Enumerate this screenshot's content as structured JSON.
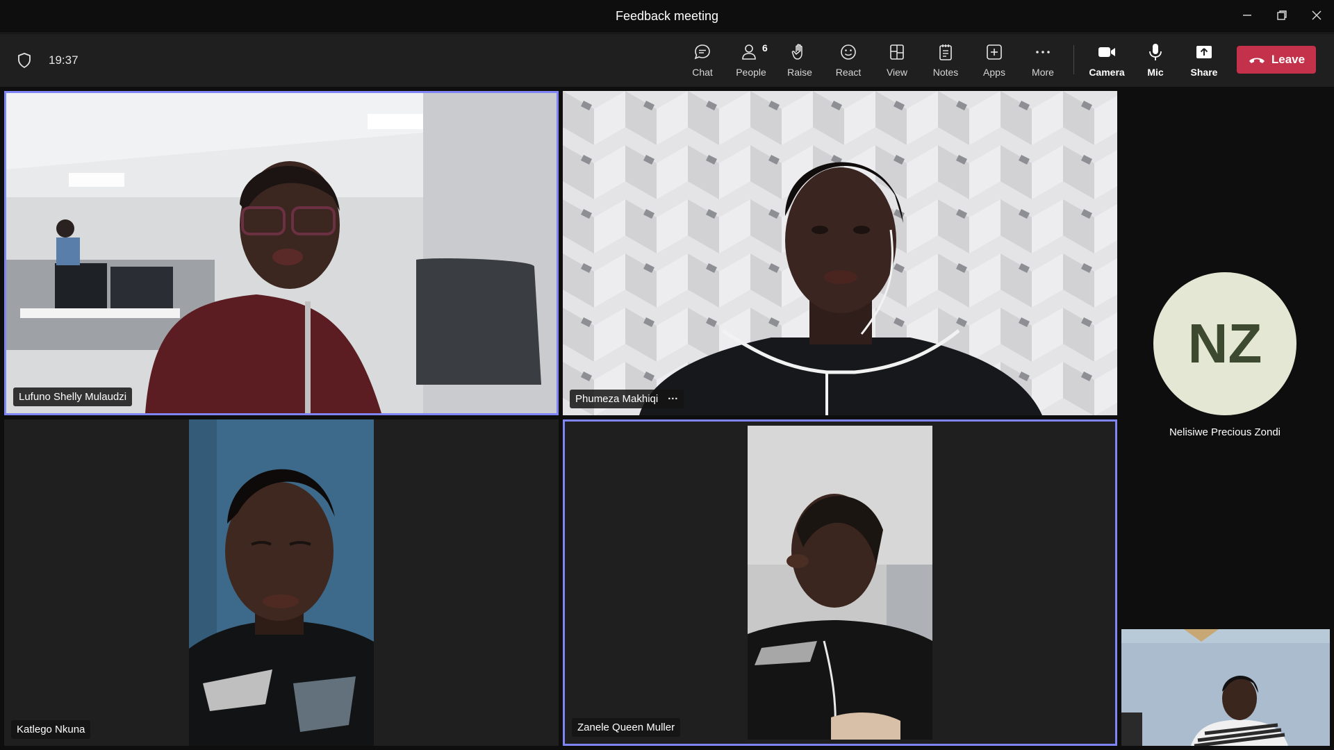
{
  "window": {
    "title": "Feedback meeting"
  },
  "toolbar": {
    "time": "19:37",
    "chat": "Chat",
    "people": "People",
    "people_count": "6",
    "raise": "Raise",
    "react": "React",
    "view": "View",
    "notes": "Notes",
    "apps": "Apps",
    "more": "More",
    "camera": "Camera",
    "mic": "Mic",
    "share": "Share",
    "leave": "Leave"
  },
  "participants": {
    "p1": {
      "name": "Lufuno Shelly Mulaudzi"
    },
    "p2": {
      "name": "Phumeza Makhiqi",
      "more": "···"
    },
    "p3": {
      "name": "Katlego Nkuna"
    },
    "p4": {
      "name": "Zanele Queen Muller"
    },
    "p5": {
      "name": "Nelisiwe Precious Zondi",
      "initials": "NZ"
    }
  },
  "colors": {
    "accent": "#7f85f5",
    "leave": "#c4314b",
    "avatar_bg": "#e3e7d3",
    "avatar_text": "#3d4a2f"
  }
}
